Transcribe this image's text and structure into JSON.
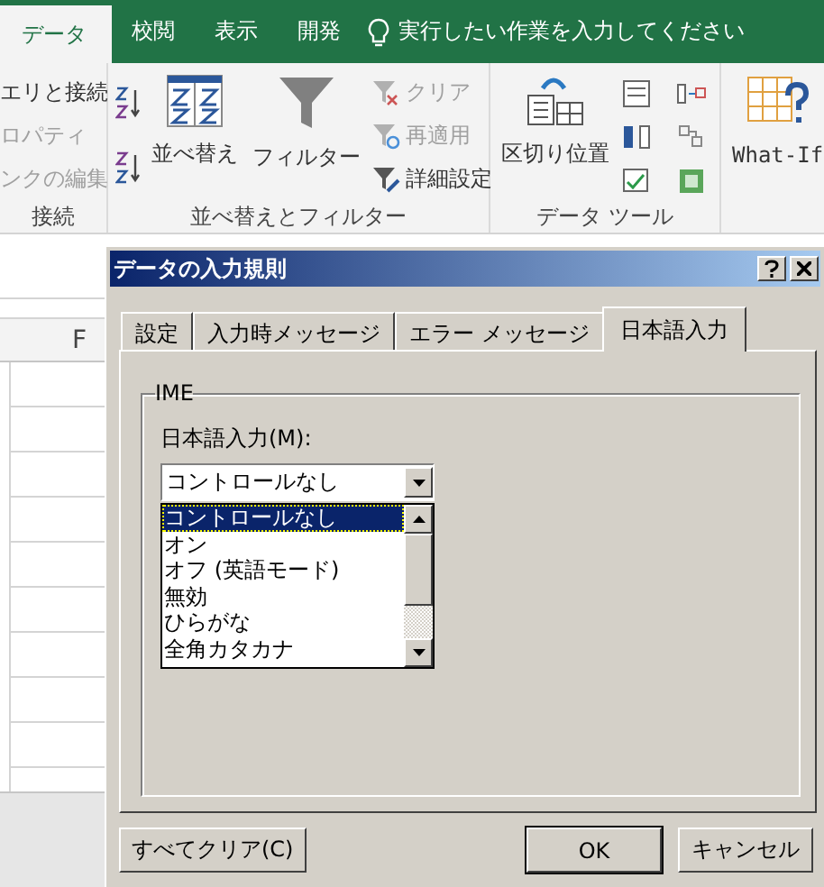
{
  "ribbon": {
    "tabs": [
      {
        "label": "データ",
        "selected": true
      },
      {
        "label": "校閲",
        "selected": false
      },
      {
        "label": "表示",
        "selected": false
      },
      {
        "label": "開発",
        "selected": false
      }
    ],
    "tell_me": "実行したい作業を入力してください",
    "groups": [
      {
        "kind": "connections",
        "label": "接続",
        "items": [
          {
            "label": "エリと接続",
            "disabled": false
          },
          {
            "label": "ロパティ",
            "disabled": true
          },
          {
            "label": "ンクの編集",
            "disabled": true
          }
        ]
      },
      {
        "kind": "sort_filter",
        "label": "並べ替えとフィルター",
        "sort": "並べ替え",
        "filter": "フィルター",
        "items": [
          {
            "label": "クリア",
            "disabled": true
          },
          {
            "label": "再適用",
            "disabled": true
          },
          {
            "label": "詳細設定",
            "disabled": false
          }
        ]
      },
      {
        "kind": "data_tools",
        "label": "データ ツール",
        "button": "区切り位置"
      },
      {
        "kind": "forecast",
        "button": "What-If"
      }
    ]
  },
  "sheet": {
    "column": "F"
  },
  "dialog": {
    "title": "データの入力規則",
    "tabs": [
      {
        "label": "設定",
        "selected": false
      },
      {
        "label": "入力時メッセージ",
        "selected": false
      },
      {
        "label": "エラー メッセージ",
        "selected": false
      },
      {
        "label": "日本語入力",
        "selected": true
      }
    ],
    "group": "IME",
    "field_label": "日本語入力(M):",
    "value": "コントロールなし",
    "options": [
      {
        "label": "コントロールなし",
        "selected": true
      },
      {
        "label": "オン",
        "selected": false
      },
      {
        "label": "オフ (英語モード)",
        "selected": false
      },
      {
        "label": "無効",
        "selected": false
      },
      {
        "label": "ひらがな",
        "selected": false
      },
      {
        "label": "全角カタカナ",
        "selected": false
      }
    ],
    "buttons": [
      {
        "label": "すべてクリア(C)",
        "default": false
      },
      {
        "label": "OK",
        "default": true
      },
      {
        "label": "キャンセル",
        "default": false
      }
    ]
  }
}
